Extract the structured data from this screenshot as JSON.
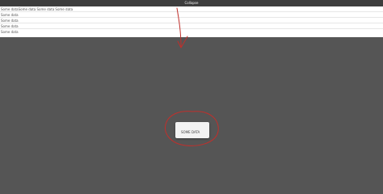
{
  "header": {
    "collapse_label": "Collapse"
  },
  "rows": [
    {
      "text": "Some dataSome data Some data Some data"
    },
    {
      "text": "Some data"
    },
    {
      "text": "Some data"
    },
    {
      "text": "Some data"
    },
    {
      "text": "Some data"
    }
  ],
  "popup": {
    "label": "SOME DATA"
  },
  "colors": {
    "page_background": "#555555",
    "top_bar": "#3d3d3d",
    "panel_background": "#ffffff",
    "annotation": "#c0302c"
  }
}
